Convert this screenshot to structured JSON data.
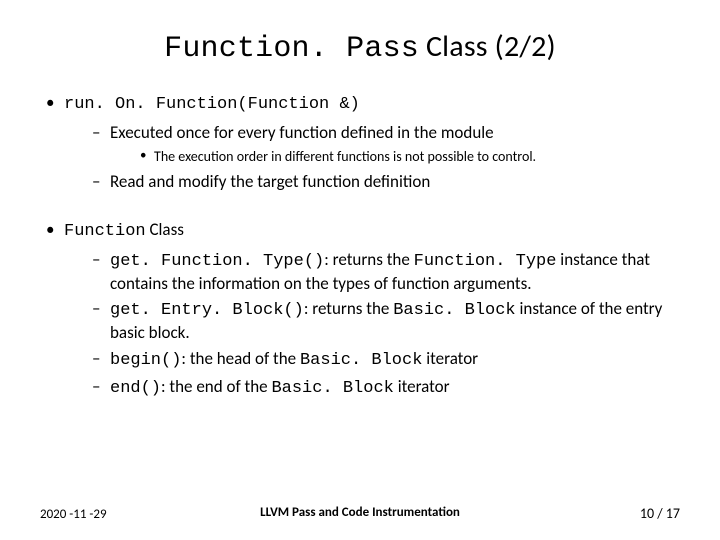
{
  "title": {
    "code": "Function. Pass",
    "rest": " Class (2/2)"
  },
  "items": [
    {
      "head_code": "run. On. Function(Function &)",
      "subs": [
        {
          "text": "Executed once for every function defined in the module",
          "sub3": "The execution order in different functions is not possible to control."
        },
        {
          "text": "Read and modify the target function definition"
        }
      ]
    },
    {
      "head_code": "Function",
      "head_text": " Class",
      "subs": [
        {
          "code": "get. Function. Type()",
          "tail": ": returns the ",
          "code2": "Function. Type",
          "tail2": " instance that contains the information on the types of function arguments."
        },
        {
          "code": "get. Entry. Block()",
          "tail": ": returns the ",
          "code2": "Basic. Block",
          "tail2": " instance of the entry basic block."
        },
        {
          "code": "begin()",
          "tail": ": the head of the ",
          "code2": "Basic. Block",
          "tail2": " iterator"
        },
        {
          "code": "end()",
          "tail": ": the end of the ",
          "code2": "Basic. Block",
          "tail2": " iterator"
        }
      ]
    }
  ],
  "footer": {
    "date": "2020 -11 -29",
    "center": "LLVM Pass and Code Instrumentation",
    "page": "10",
    "sep": " / ",
    "total": "17"
  }
}
